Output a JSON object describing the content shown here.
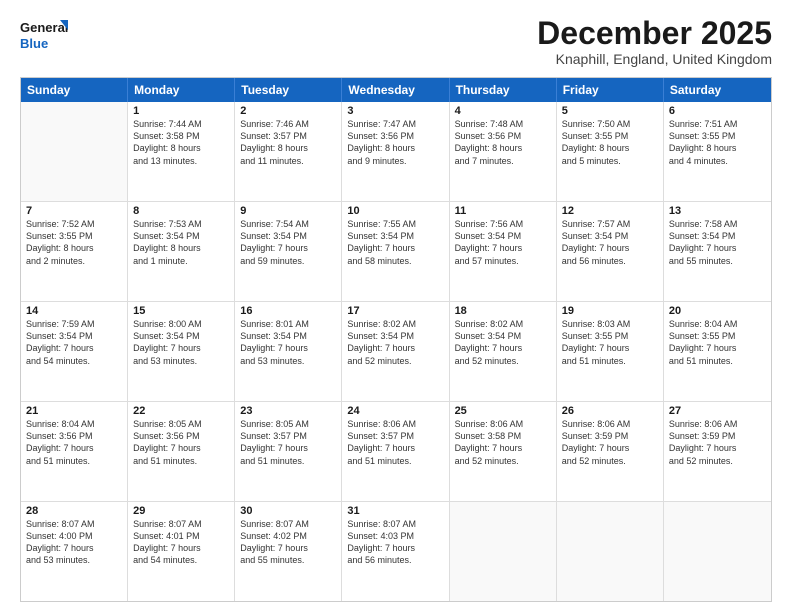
{
  "logo": {
    "line1": "General",
    "line2": "Blue"
  },
  "title": "December 2025",
  "location": "Knaphill, England, United Kingdom",
  "days_of_week": [
    "Sunday",
    "Monday",
    "Tuesday",
    "Wednesday",
    "Thursday",
    "Friday",
    "Saturday"
  ],
  "weeks": [
    [
      {
        "day": "",
        "info": ""
      },
      {
        "day": "1",
        "info": "Sunrise: 7:44 AM\nSunset: 3:58 PM\nDaylight: 8 hours\nand 13 minutes."
      },
      {
        "day": "2",
        "info": "Sunrise: 7:46 AM\nSunset: 3:57 PM\nDaylight: 8 hours\nand 11 minutes."
      },
      {
        "day": "3",
        "info": "Sunrise: 7:47 AM\nSunset: 3:56 PM\nDaylight: 8 hours\nand 9 minutes."
      },
      {
        "day": "4",
        "info": "Sunrise: 7:48 AM\nSunset: 3:56 PM\nDaylight: 8 hours\nand 7 minutes."
      },
      {
        "day": "5",
        "info": "Sunrise: 7:50 AM\nSunset: 3:55 PM\nDaylight: 8 hours\nand 5 minutes."
      },
      {
        "day": "6",
        "info": "Sunrise: 7:51 AM\nSunset: 3:55 PM\nDaylight: 8 hours\nand 4 minutes."
      }
    ],
    [
      {
        "day": "7",
        "info": "Sunrise: 7:52 AM\nSunset: 3:55 PM\nDaylight: 8 hours\nand 2 minutes."
      },
      {
        "day": "8",
        "info": "Sunrise: 7:53 AM\nSunset: 3:54 PM\nDaylight: 8 hours\nand 1 minute."
      },
      {
        "day": "9",
        "info": "Sunrise: 7:54 AM\nSunset: 3:54 PM\nDaylight: 7 hours\nand 59 minutes."
      },
      {
        "day": "10",
        "info": "Sunrise: 7:55 AM\nSunset: 3:54 PM\nDaylight: 7 hours\nand 58 minutes."
      },
      {
        "day": "11",
        "info": "Sunrise: 7:56 AM\nSunset: 3:54 PM\nDaylight: 7 hours\nand 57 minutes."
      },
      {
        "day": "12",
        "info": "Sunrise: 7:57 AM\nSunset: 3:54 PM\nDaylight: 7 hours\nand 56 minutes."
      },
      {
        "day": "13",
        "info": "Sunrise: 7:58 AM\nSunset: 3:54 PM\nDaylight: 7 hours\nand 55 minutes."
      }
    ],
    [
      {
        "day": "14",
        "info": "Sunrise: 7:59 AM\nSunset: 3:54 PM\nDaylight: 7 hours\nand 54 minutes."
      },
      {
        "day": "15",
        "info": "Sunrise: 8:00 AM\nSunset: 3:54 PM\nDaylight: 7 hours\nand 53 minutes."
      },
      {
        "day": "16",
        "info": "Sunrise: 8:01 AM\nSunset: 3:54 PM\nDaylight: 7 hours\nand 53 minutes."
      },
      {
        "day": "17",
        "info": "Sunrise: 8:02 AM\nSunset: 3:54 PM\nDaylight: 7 hours\nand 52 minutes."
      },
      {
        "day": "18",
        "info": "Sunrise: 8:02 AM\nSunset: 3:54 PM\nDaylight: 7 hours\nand 52 minutes."
      },
      {
        "day": "19",
        "info": "Sunrise: 8:03 AM\nSunset: 3:55 PM\nDaylight: 7 hours\nand 51 minutes."
      },
      {
        "day": "20",
        "info": "Sunrise: 8:04 AM\nSunset: 3:55 PM\nDaylight: 7 hours\nand 51 minutes."
      }
    ],
    [
      {
        "day": "21",
        "info": "Sunrise: 8:04 AM\nSunset: 3:56 PM\nDaylight: 7 hours\nand 51 minutes."
      },
      {
        "day": "22",
        "info": "Sunrise: 8:05 AM\nSunset: 3:56 PM\nDaylight: 7 hours\nand 51 minutes."
      },
      {
        "day": "23",
        "info": "Sunrise: 8:05 AM\nSunset: 3:57 PM\nDaylight: 7 hours\nand 51 minutes."
      },
      {
        "day": "24",
        "info": "Sunrise: 8:06 AM\nSunset: 3:57 PM\nDaylight: 7 hours\nand 51 minutes."
      },
      {
        "day": "25",
        "info": "Sunrise: 8:06 AM\nSunset: 3:58 PM\nDaylight: 7 hours\nand 52 minutes."
      },
      {
        "day": "26",
        "info": "Sunrise: 8:06 AM\nSunset: 3:59 PM\nDaylight: 7 hours\nand 52 minutes."
      },
      {
        "day": "27",
        "info": "Sunrise: 8:06 AM\nSunset: 3:59 PM\nDaylight: 7 hours\nand 52 minutes."
      }
    ],
    [
      {
        "day": "28",
        "info": "Sunrise: 8:07 AM\nSunset: 4:00 PM\nDaylight: 7 hours\nand 53 minutes."
      },
      {
        "day": "29",
        "info": "Sunrise: 8:07 AM\nSunset: 4:01 PM\nDaylight: 7 hours\nand 54 minutes."
      },
      {
        "day": "30",
        "info": "Sunrise: 8:07 AM\nSunset: 4:02 PM\nDaylight: 7 hours\nand 55 minutes."
      },
      {
        "day": "31",
        "info": "Sunrise: 8:07 AM\nSunset: 4:03 PM\nDaylight: 7 hours\nand 56 minutes."
      },
      {
        "day": "",
        "info": ""
      },
      {
        "day": "",
        "info": ""
      },
      {
        "day": "",
        "info": ""
      }
    ]
  ]
}
